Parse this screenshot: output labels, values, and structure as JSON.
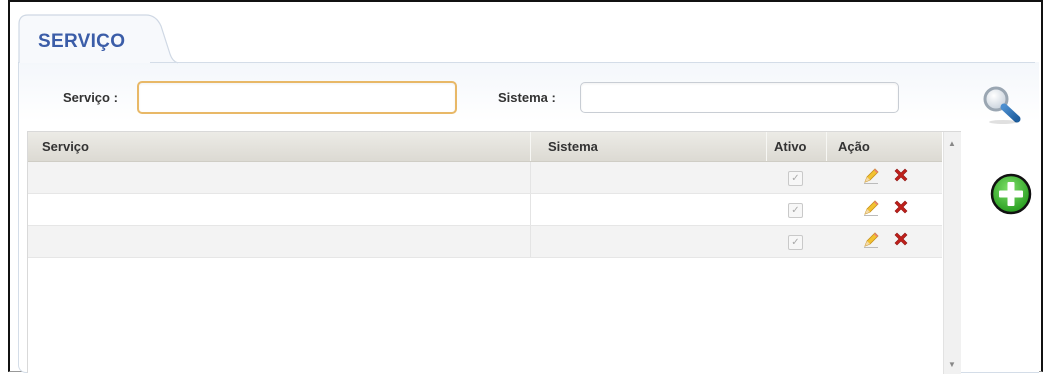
{
  "tab": {
    "title": "SERVIÇO"
  },
  "filters": {
    "servico_label": "Serviço :",
    "servico_value": "",
    "sistema_label": "Sistema :",
    "sistema_value": ""
  },
  "grid": {
    "columns": [
      "Serviço",
      "Sistema",
      "Ativo",
      "Ação"
    ],
    "rows": [
      {
        "servico": "",
        "sistema": "",
        "ativo": true
      },
      {
        "servico": "",
        "sistema": "",
        "ativo": true
      },
      {
        "servico": "",
        "sistema": "",
        "ativo": true
      }
    ]
  },
  "icons": {
    "search": "magnifier-icon",
    "add": "plus-circle-icon",
    "edit": "pencil-icon",
    "delete": "red-x-icon",
    "scroll_up": "triangle-up-icon",
    "scroll_down": "triangle-down-icon"
  },
  "colors": {
    "title": "#3b5da8",
    "focus_border": "#e8b867",
    "add_green": "#3dbb2f",
    "delete_red": "#c0201b"
  }
}
